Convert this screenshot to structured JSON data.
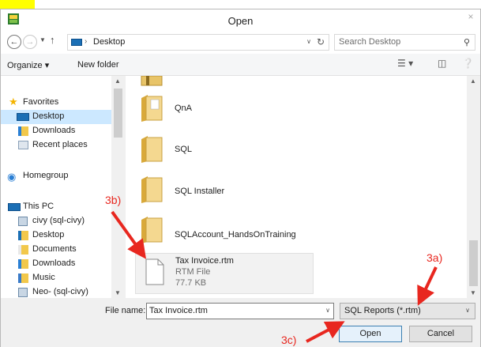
{
  "window": {
    "title": "Open",
    "close_glyph": "×"
  },
  "address": {
    "path": "Desktop",
    "search_placeholder": "Search Desktop"
  },
  "toolbar": {
    "organize": "Organize ▾",
    "new_folder": "New folder"
  },
  "sidebar": {
    "items": [
      {
        "label": "Favorites",
        "icon": "star-icon"
      },
      {
        "label": "Desktop",
        "icon": "desktop-icon",
        "selected": true
      },
      {
        "label": "Downloads",
        "icon": "downloads-icon"
      },
      {
        "label": "Recent places",
        "icon": "recent-places-icon"
      },
      {
        "label": "Homegroup",
        "icon": "homegroup-icon"
      },
      {
        "label": "This PC",
        "icon": "computer-icon"
      },
      {
        "label": "civy (sql-civy)",
        "icon": "network-user-icon"
      },
      {
        "label": "Desktop",
        "icon": "desktop-folder-icon"
      },
      {
        "label": "Documents",
        "icon": "documents-icon"
      },
      {
        "label": "Downloads",
        "icon": "downloads-icon"
      },
      {
        "label": "Music",
        "icon": "music-icon"
      },
      {
        "label": "Neo- (sql-civy)",
        "icon": "network-user-icon"
      }
    ]
  },
  "files": {
    "items": [
      {
        "label": "QnA"
      },
      {
        "label": "SQL"
      },
      {
        "label": "SQL Installer"
      },
      {
        "label": "SQLAccount_HandsOnTraining"
      }
    ],
    "selected_file": {
      "name": "Tax Invoice.rtm",
      "type": "RTM File",
      "size": "77.7 KB"
    }
  },
  "bottom": {
    "file_name_label": "File name:",
    "file_name_value": "Tax Invoice.rtm",
    "file_type": "SQL Reports (*.rtm)",
    "open": "Open",
    "cancel": "Cancel"
  },
  "annotations": {
    "a": "3a)",
    "b": "3b)",
    "c": "3c)"
  },
  "colors": {
    "annotation": "#e8271f",
    "highlight_tab": "#ffff00",
    "selection": "#cce8ff"
  }
}
